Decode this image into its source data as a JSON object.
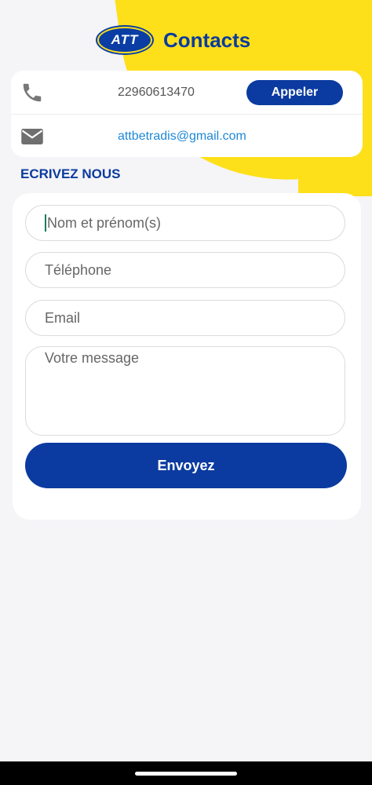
{
  "header": {
    "logo_text": "ATT",
    "title": "Contacts"
  },
  "contact": {
    "phone": "22960613470",
    "call_label": "Appeler",
    "email": "attbetradis@gmail.com"
  },
  "section_title": "ECRIVEZ NOUS",
  "form": {
    "name_placeholder": "Nom et prénom(s)",
    "phone_placeholder": "Téléphone",
    "email_placeholder": "Email",
    "message_placeholder": "Votre message",
    "submit_label": "Envoyez"
  },
  "colors": {
    "brand_blue": "#0b3ba0",
    "accent_yellow": "#fde01a",
    "link": "#1e88d8"
  },
  "icons": [
    "phone-icon",
    "mail-icon"
  ]
}
